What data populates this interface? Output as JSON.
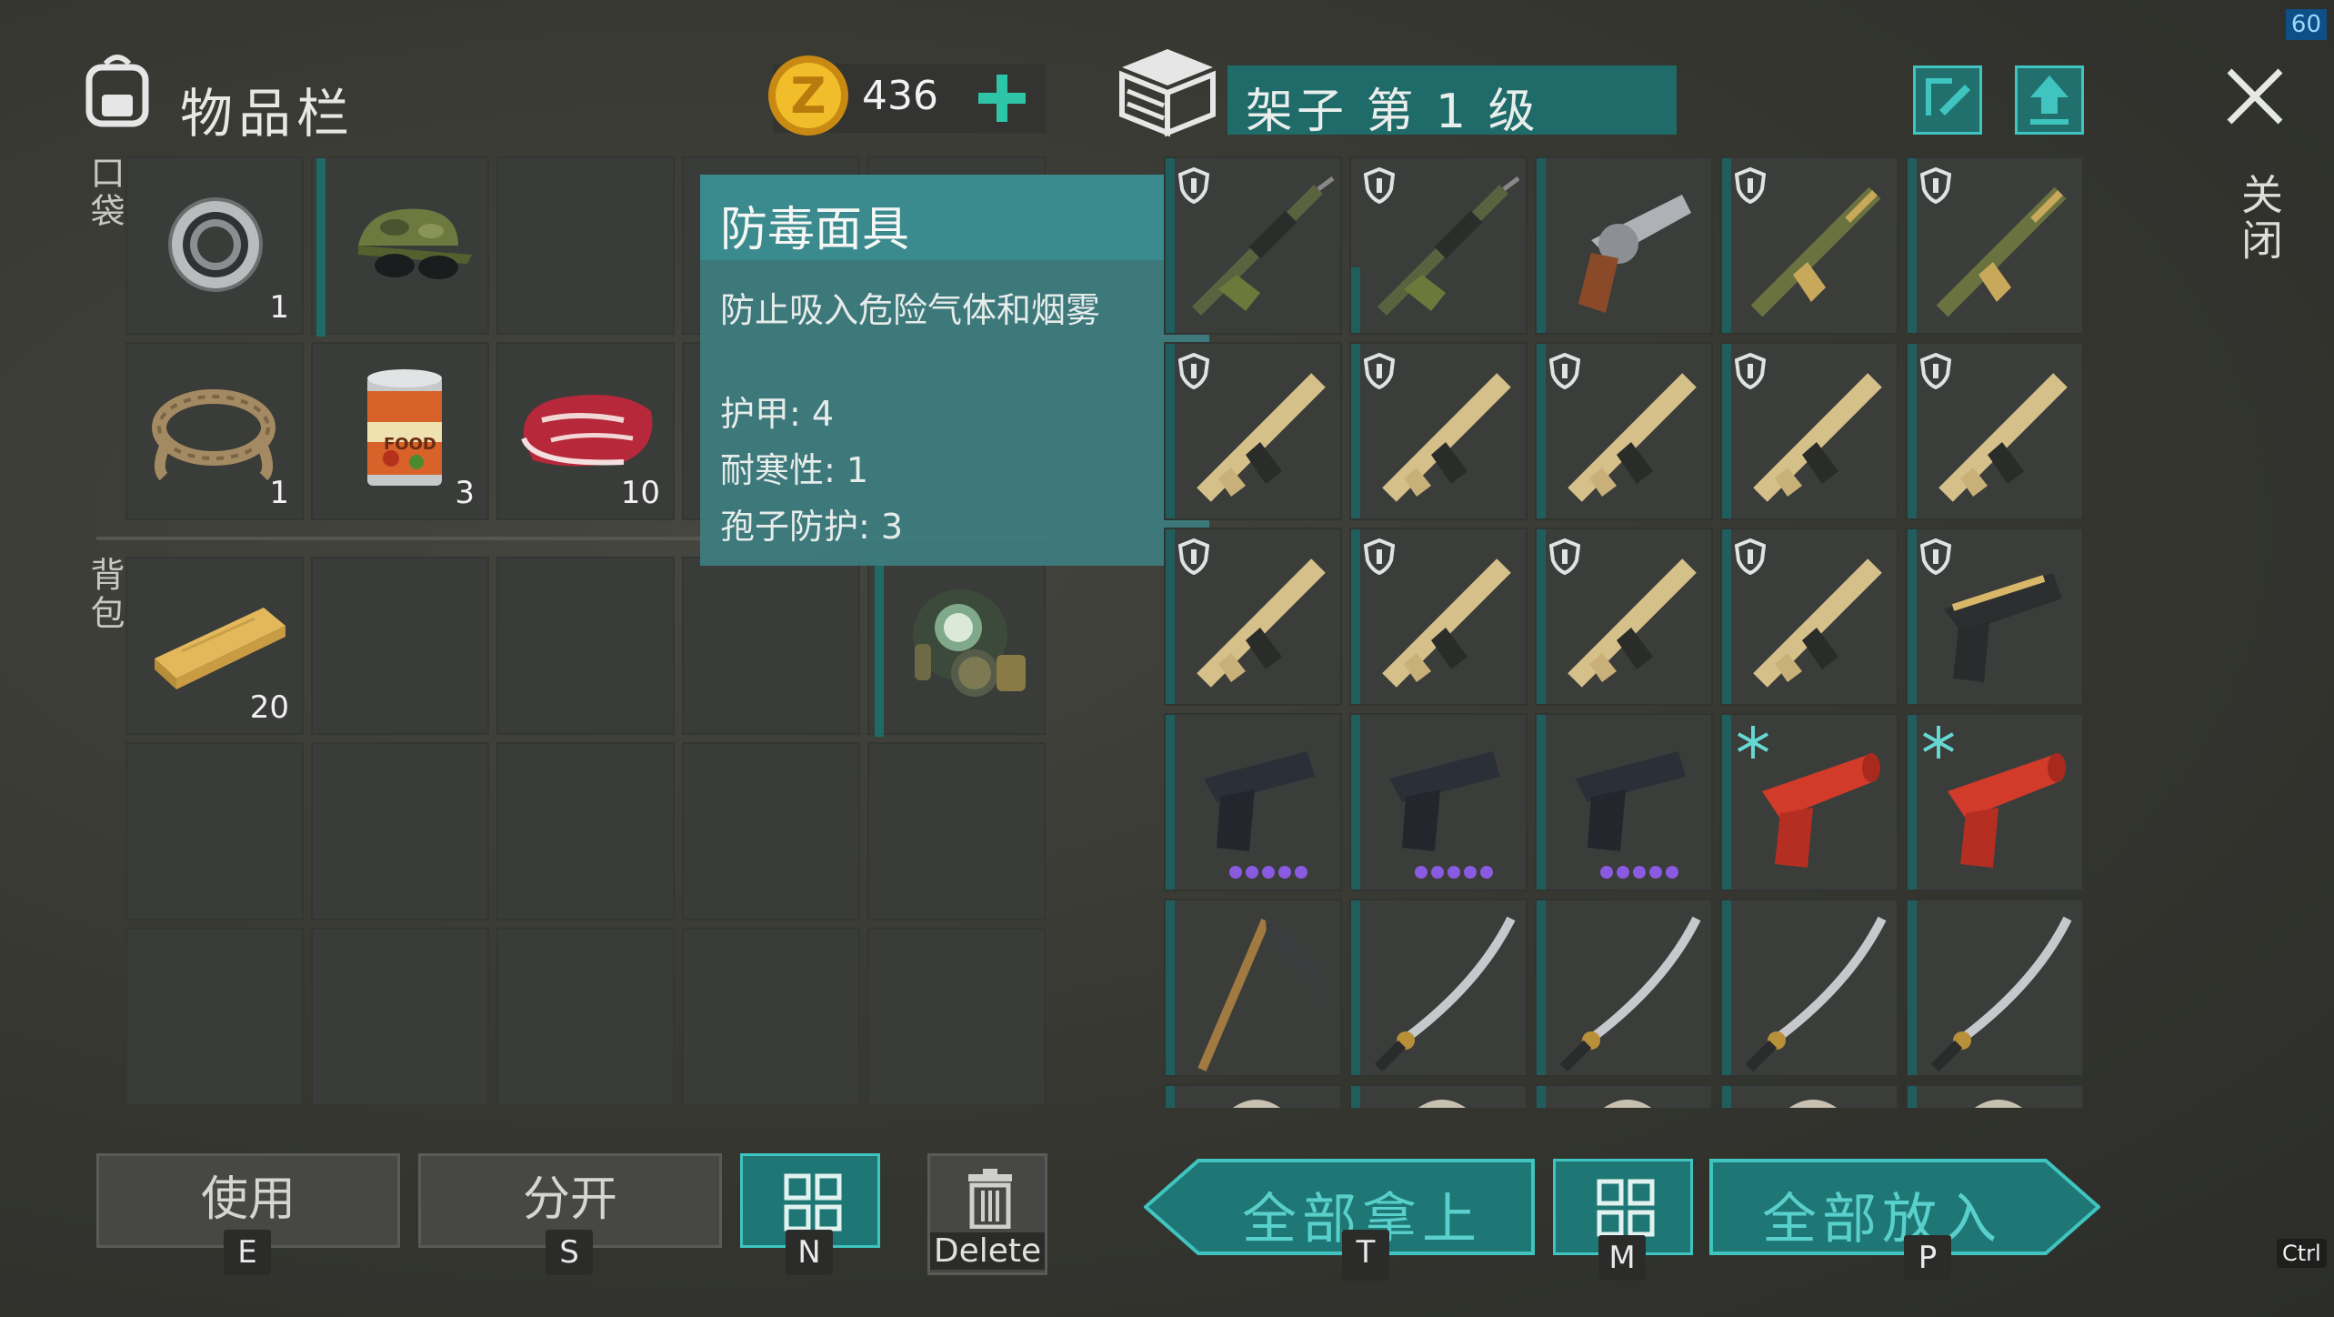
{
  "fps": "60",
  "inventory": {
    "title": "物品栏",
    "pocket_label": "口袋",
    "backpack_label": "背包",
    "coins": "436",
    "pocket_items": [
      {
        "name": "bearing",
        "count": "1"
      },
      {
        "name": "camo-cap-with-glasses",
        "count": ""
      },
      {
        "name": "empty",
        "count": ""
      },
      {
        "name": "rope",
        "count": "1"
      },
      {
        "name": "food-can",
        "count": "3"
      },
      {
        "name": "raw-meat",
        "count": "10"
      }
    ],
    "backpack_items": [
      {
        "name": "wood-plank",
        "count": "20"
      },
      {
        "name": "gas-mask",
        "count": ""
      }
    ],
    "can_label": "FOOD"
  },
  "tooltip": {
    "title": "防毒面具",
    "description": "防止吸入危险气体和烟雾",
    "stats": [
      "护甲: 4",
      "耐寒性: 1",
      "孢子防护: 3"
    ]
  },
  "container": {
    "title": "架子 第 1 级"
  },
  "buttons": {
    "use": "使用",
    "use_key": "E",
    "split": "分开",
    "split_key": "S",
    "sort_key": "N",
    "delete": "Delete",
    "take_all": "全部拿上",
    "take_all_key": "T",
    "sort2_key": "M",
    "put_all": "全部放入",
    "put_all_key": "P"
  },
  "close_label": "关闭",
  "ctrl_hint": "Ctrl",
  "colors": {
    "accent_teal": "#1f7775",
    "teal_text": "#59d0cc",
    "tooltip_bg": "#3d7d80",
    "purple_dot": "#8a5ae0"
  }
}
